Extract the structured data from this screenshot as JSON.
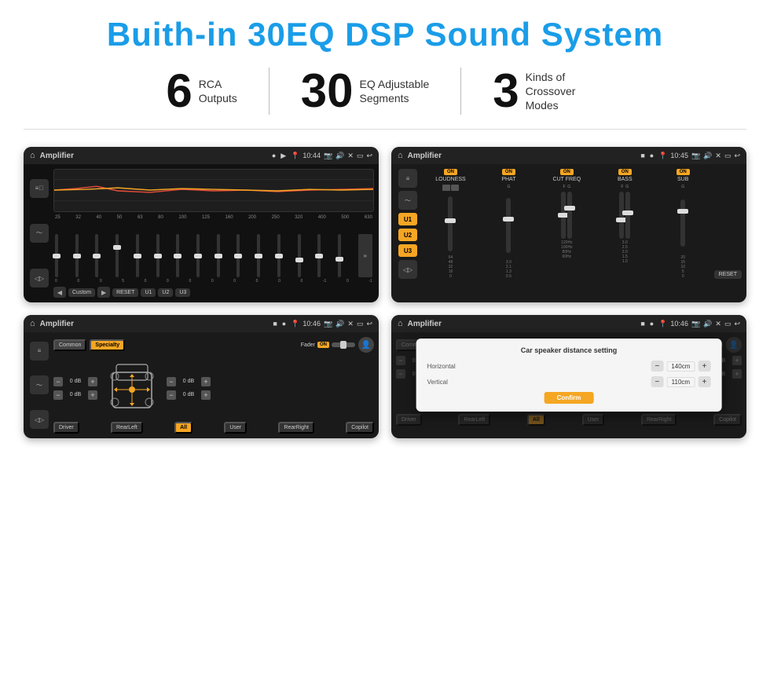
{
  "page": {
    "title": "Buith-in 30EQ DSP Sound System"
  },
  "stats": [
    {
      "number": "6",
      "label": "RCA\nOutputs"
    },
    {
      "number": "30",
      "label": "EQ Adjustable\nSegments"
    },
    {
      "number": "3",
      "label": "Kinds of\nCrossover Modes"
    }
  ],
  "screens": {
    "eq": {
      "app_name": "Amplifier",
      "time": "10:44",
      "freq_labels": [
        "25",
        "32",
        "40",
        "50",
        "63",
        "80",
        "100",
        "125",
        "160",
        "200",
        "250",
        "320",
        "400",
        "500",
        "630"
      ],
      "values": [
        "0",
        "0",
        "0",
        "5",
        "0",
        "0",
        "0",
        "0",
        "0",
        "0",
        "0",
        "0",
        "-1",
        "0",
        "-1"
      ],
      "buttons": [
        "Custom",
        "RESET",
        "U1",
        "U2",
        "U3"
      ]
    },
    "crossover": {
      "app_name": "Amplifier",
      "time": "10:45",
      "u_buttons": [
        "U1",
        "U2",
        "U3"
      ],
      "channels": [
        "LOUDNESS",
        "PHAT",
        "CUT FREQ",
        "BASS",
        "SUB"
      ],
      "on_label": "ON",
      "reset_label": "RESET"
    },
    "balance": {
      "app_name": "Amplifier",
      "time": "10:46",
      "common_label": "Common",
      "specialty_label": "Specialty",
      "fader_label": "Fader",
      "on_label": "ON",
      "db_values": [
        "0 dB",
        "0 dB",
        "0 dB",
        "0 dB"
      ],
      "bottom_buttons": [
        "Driver",
        "RearLeft",
        "All",
        "User",
        "RearRight",
        "Copilot"
      ]
    },
    "dialog": {
      "app_name": "Amplifier",
      "time": "10:46",
      "title": "Car speaker distance setting",
      "horizontal_label": "Horizontal",
      "horizontal_value": "140cm",
      "vertical_label": "Vertical",
      "vertical_value": "110cm",
      "confirm_label": "Confirm",
      "db_values": [
        "0 dB",
        "0 dB"
      ],
      "minus_symbol": "−",
      "plus_symbol": "+"
    }
  }
}
